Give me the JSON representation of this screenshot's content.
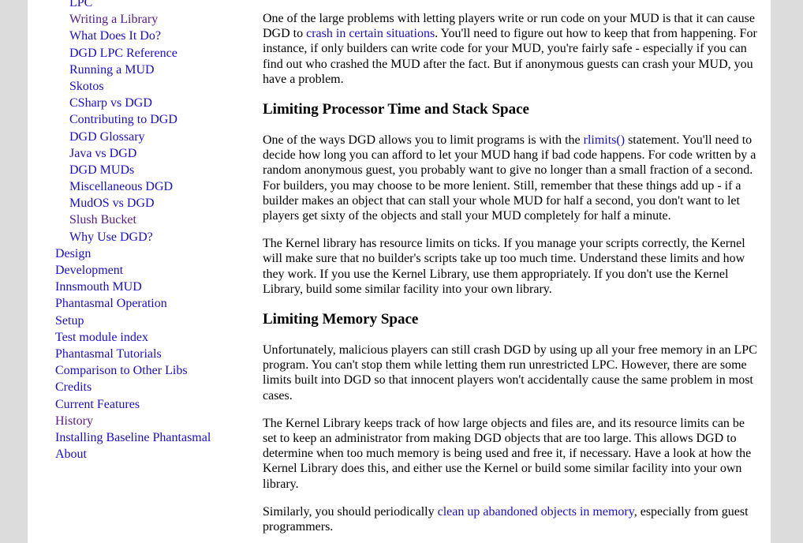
{
  "sidebar": {
    "sub_items": [
      {
        "label": "LPC",
        "visited": false
      },
      {
        "label": "Writing a Library",
        "visited": true
      },
      {
        "label": "What Does It Do?",
        "visited": false
      },
      {
        "label": "DGD LPC Reference",
        "visited": false
      },
      {
        "label": "Running a MUD",
        "visited": false
      },
      {
        "label": "Skotos",
        "visited": false
      },
      {
        "label": "CSharp vs DGD",
        "visited": false
      },
      {
        "label": "Contributing to DGD",
        "visited": false
      },
      {
        "label": "DGD Glossary",
        "visited": false
      },
      {
        "label": "Java vs DGD",
        "visited": false
      },
      {
        "label": "DGD MUDs",
        "visited": false
      },
      {
        "label": "Miscellaneous DGD",
        "visited": false
      },
      {
        "label": "MudOS vs DGD",
        "visited": false
      },
      {
        "label": "Slush Bucket",
        "visited": true
      },
      {
        "label": "Why Use DGD?",
        "visited": false
      }
    ],
    "top_items": [
      {
        "label": "Design",
        "visited": false
      },
      {
        "label": "Development",
        "visited": false
      },
      {
        "label": "Innsmouth MUD",
        "visited": false
      },
      {
        "label": "Phantasmal Operation",
        "visited": false
      },
      {
        "label": "Setup",
        "visited": false
      },
      {
        "label": "Test module index",
        "visited": false
      },
      {
        "label": "Phantasmal Tutorials",
        "visited": false
      },
      {
        "label": "Comparison to Other Libs",
        "visited": false
      },
      {
        "label": "Credits",
        "visited": false
      },
      {
        "label": "Current Features",
        "visited": false
      },
      {
        "label": "History",
        "visited": true
      },
      {
        "label": "Installing Baseline Phantasmal",
        "visited": false
      },
      {
        "label": "About",
        "visited": false
      }
    ]
  },
  "content": {
    "p1": {
      "t1": "One of the large problems with letting players write or run code on your MUD is that it can cause DGD to ",
      "link": "crash in certain situations",
      "t2": ". You'll need to figure out how to keep that from happening. For instance, if only builders can write code for your MUD, you're fairly safe - especially if you can find out who crashed the MUD after the fact. But if anonymous guests can crash your MUD, you have a problem."
    },
    "h1": "Limiting Processor Time and Stack Space",
    "p2": {
      "t1": "One of the ways DGD allows you to limit programs is with the ",
      "link": "rlimits()",
      "t2": " statement. You'll need to decide how long you can afford to let your MUD hang if bad code happens. For code written by a random anonymous guest, you probably want to give no longer than a small fraction of a second. For builders, you may choose to be more lenient. Still, remember that these things add up - if a builder makes an object that can stall your whole MUD for half a second, you don't want to let players get sixty of the objects and stall your MUD completely for half a minute."
    },
    "p3": "The Kernel library has resource limits on ticks. If you manage your scripts correctly, the Kernel will make sure that no builder's scripts take up too much time. Understand these limits and how they work. If you use the Kernel Library, use them appropriately. If you don't use the Kernel Library, build some similar facility into your own library.",
    "h2": "Limiting Memory Space",
    "p4": "Unfortunately, malicious players can still crash DGD by using up all your free memory in an LPC program. You can't stop them while letting them run unrestricted LPC. However, there are some limits built into DGD so that innocent players won't accidentally cause the same problem in most cases.",
    "p5": "The Kernel Library keeps track of how large objects and files are, and its resource limits can be set to keep an administrator from making DGD objects that are too large. This allows DGD to determine when too much memory is being used and free it, if necessary. Have a look at how the Kernel Library does this, and either use the Kernel or build some similar facility into your own library.",
    "p6": {
      "t1": "Similarly, you should periodically ",
      "link": "clean up abandoned objects in memory",
      "t2": ", especially from guest programmers."
    }
  },
  "colors": {
    "link": "#1a0dcc",
    "visited": "#551a8b",
    "background": "#dcdcdc",
    "page": "#ffffff"
  }
}
